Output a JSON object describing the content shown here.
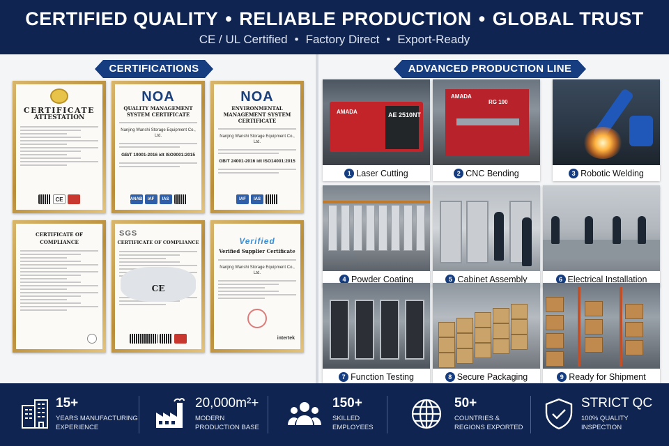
{
  "header": {
    "headline_parts": [
      "CERTIFIED QUALITY",
      "RELIABLE PRODUCTION",
      "GLOBAL TRUST"
    ],
    "separator": "•",
    "sub_parts": [
      "CE / UL Certified",
      "Factory Direct",
      "Export-Ready"
    ]
  },
  "certifications": {
    "title": "CERTIFICATIONS",
    "items": [
      {
        "title": "CERTIFICATE",
        "subtitle": "ATTESTATION",
        "marks": [
          "CE"
        ]
      },
      {
        "logo": "NOA",
        "title": "QUALITY MANAGEMENT SYSTEM CERTIFICATE",
        "company": "Nanjing Wanshi Storage Equipment Co., Ltd.",
        "standard": "GB/T 19001-2016 idt ISO9001:2015",
        "marks": [
          "ANAB",
          "IAF",
          "IAS"
        ]
      },
      {
        "logo": "NOA",
        "title": "ENVIRONMENTAL MANAGEMENT SYSTEM CERTIFICATE",
        "company": "Nanjing Wanshi Storage Equipment Co., Ltd.",
        "standard": "GB/T 24001-2016 idt ISO14001:2015",
        "marks": [
          "IAF",
          "IAS"
        ]
      },
      {
        "title": "CERTIFICATE OF COMPLIANCE",
        "marks": []
      },
      {
        "logo": "SGS",
        "title": "CERTIFICATE OF COMPLIANCE",
        "mark": "CE"
      },
      {
        "logo": "Verified",
        "title": "Verified Supplier Certificate",
        "company": "Nanjing Wanshi Storage Equipment Co., Ltd.",
        "issuer": "intertek"
      }
    ]
  },
  "production": {
    "title": "ADVANCED PRODUCTION LINE",
    "steps": [
      {
        "num": "1",
        "label": "Laser Cutting",
        "machine_text": "AE 2510NT",
        "brand_text": "AMADA"
      },
      {
        "num": "2",
        "label": "CNC Bending",
        "machine_text": "RG 100",
        "brand_text": "AMADA"
      },
      {
        "num": "3",
        "label": "Robotic Welding"
      },
      {
        "num": "4",
        "label": "Powder Coating"
      },
      {
        "num": "5",
        "label": "Cabinet Assembly"
      },
      {
        "num": "6",
        "label": "Electrical Installation"
      },
      {
        "num": "7",
        "label": "Function Testing"
      },
      {
        "num": "8",
        "label": "Secure Packaging"
      },
      {
        "num": "9",
        "label": "Ready for Shipment"
      }
    ]
  },
  "stats": [
    {
      "icon": "building-icon",
      "value": "15+",
      "label_line1": "YEARS MANUFACTURING",
      "label_line2": "EXPERIENCE"
    },
    {
      "icon": "factory-icon",
      "value": "20,000m²+",
      "label_line1": "MODERN",
      "label_line2": "PRODUCTION BASE"
    },
    {
      "icon": "people-icon",
      "value": "150+",
      "label_line1": "SKILLED",
      "label_line2": "EMPLOYEES"
    },
    {
      "icon": "globe-icon",
      "value": "50+",
      "label_line1": "COUNTRIES &",
      "label_line2": "REGIONS EXPORTED"
    },
    {
      "icon": "shield-check-icon",
      "value": "STRICT QC",
      "label_line1": "100% QUALITY",
      "label_line2": "INSPECTION"
    }
  ],
  "colors": {
    "navy": "#0f2450",
    "ribbon": "#163d80",
    "gold": "#c9a24e"
  }
}
